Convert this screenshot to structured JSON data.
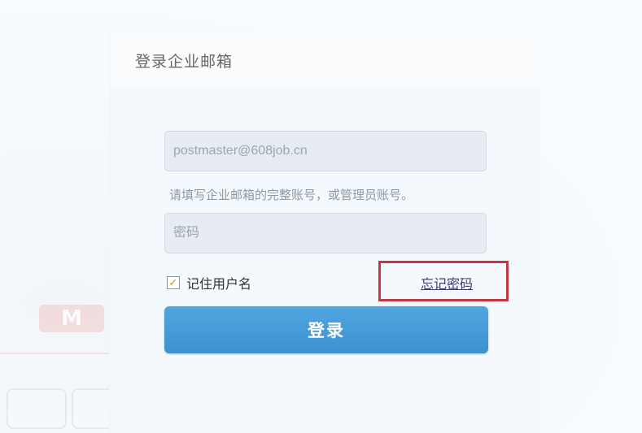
{
  "card": {
    "title": "登录企业邮箱"
  },
  "form": {
    "username_value": "postmaster@608job.cn",
    "username_hint": "请填写企业邮箱的完整账号，或管理员账号。",
    "password_placeholder": "密码",
    "remember_label": "记住用户名",
    "remember_checked": true,
    "forgot_password_label": "忘记密码",
    "login_button_label": "登录"
  },
  "colors": {
    "login_button": "#3c91d1",
    "highlight_box": "#c6383f",
    "check_mark": "#e08a10"
  },
  "icons": {
    "checkbox_mark": "✓"
  }
}
